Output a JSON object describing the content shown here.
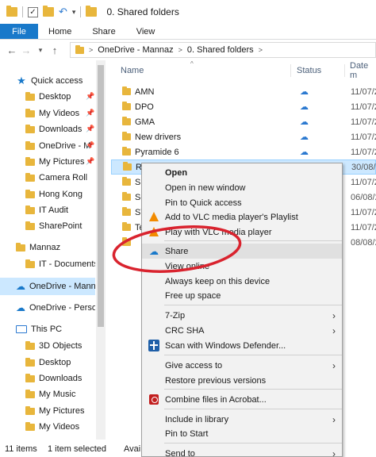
{
  "window": {
    "title": "0. Shared folders"
  },
  "ribbon": {
    "file": "File",
    "tabs": [
      "Home",
      "Share",
      "View"
    ]
  },
  "address": {
    "crumbs": [
      "OneDrive - Mannaz",
      "0. Shared folders"
    ],
    "separator": ">"
  },
  "nav": {
    "items": [
      {
        "label": "Quick access",
        "icon": "star-icon"
      },
      {
        "label": "Desktop",
        "icon": "folder-icon",
        "pinned": true
      },
      {
        "label": "My Videos",
        "icon": "folder-icon",
        "pinned": true
      },
      {
        "label": "Downloads",
        "icon": "folder-icon",
        "pinned": true
      },
      {
        "label": "OneDrive - M",
        "icon": "folder-icon",
        "pinned": true
      },
      {
        "label": "My Pictures",
        "icon": "folder-icon",
        "pinned": true
      },
      {
        "label": "Camera Roll",
        "icon": "folder-icon"
      },
      {
        "label": "Hong Kong",
        "icon": "folder-icon"
      },
      {
        "label": "IT Audit",
        "icon": "folder-icon"
      },
      {
        "label": "SharePoint",
        "icon": "folder-icon"
      },
      {
        "label": "Mannaz",
        "icon": "folder-icon"
      },
      {
        "label": "IT - Documents",
        "icon": "folder-icon"
      },
      {
        "label": "OneDrive - Manna",
        "icon": "cloud-icon"
      },
      {
        "label": "OneDrive - Person",
        "icon": "cloud-icon"
      },
      {
        "label": "This PC",
        "icon": "pc-icon"
      },
      {
        "label": "3D Objects",
        "icon": "folder-icon"
      },
      {
        "label": "Desktop",
        "icon": "folder-icon"
      },
      {
        "label": "Downloads",
        "icon": "folder-icon"
      },
      {
        "label": "My Music",
        "icon": "folder-icon"
      },
      {
        "label": "My Pictures",
        "icon": "folder-icon"
      },
      {
        "label": "My Videos",
        "icon": "folder-icon"
      }
    ],
    "pin_glyph": "📌"
  },
  "columns": {
    "name": "Name",
    "status": "Status",
    "date": "Date m"
  },
  "files": [
    {
      "name": "AMN",
      "date": "11/07/2"
    },
    {
      "name": "DPO",
      "date": "11/07/2"
    },
    {
      "name": "GMA",
      "date": "11/07/2"
    },
    {
      "name": "New drivers",
      "date": "11/07/2"
    },
    {
      "name": "Pyramide 6",
      "date": "11/07/2"
    },
    {
      "name": "RTU",
      "date": "30/08/2"
    },
    {
      "name": "SD",
      "date": "11/07/2"
    },
    {
      "name": "Se",
      "date": "06/08/2"
    },
    {
      "name": "ST",
      "date": "11/07/2"
    },
    {
      "name": "Te",
      "date": "11/07/2"
    },
    {
      "name": "",
      "date": "08/08/2"
    }
  ],
  "status_cloud": "☁",
  "statusbar": {
    "count": "11 items",
    "selected": "1 item selected",
    "avail": "Availa"
  },
  "menu": {
    "items": [
      {
        "label": "Open",
        "bold": true
      },
      {
        "label": "Open in new window"
      },
      {
        "label": "Pin to Quick access"
      },
      {
        "label": "Add to VLC media player's Playlist",
        "icon": "vlc-icon"
      },
      {
        "label": "Play with VLC media player",
        "icon": "vlc-icon"
      },
      {
        "label": "Share",
        "icon": "cloud-icon",
        "highlight": true
      },
      {
        "label": "View online"
      },
      {
        "label": "Always keep on this device"
      },
      {
        "label": "Free up space"
      },
      {
        "label": "7-Zip",
        "submenu": true
      },
      {
        "label": "CRC SHA",
        "submenu": true
      },
      {
        "label": "Scan with Windows Defender...",
        "icon": "shield-icon"
      },
      {
        "label": "Give access to",
        "submenu": true
      },
      {
        "label": "Restore previous versions"
      },
      {
        "label": "Combine files in Acrobat...",
        "icon": "acrobat-icon"
      },
      {
        "label": "Include in library",
        "submenu": true
      },
      {
        "label": "Pin to Start"
      },
      {
        "label": "Send to",
        "submenu": true
      }
    ]
  },
  "colors": {
    "accent": "#1979ca",
    "selection": "#cce8ff",
    "annotation": "#d9232e"
  }
}
